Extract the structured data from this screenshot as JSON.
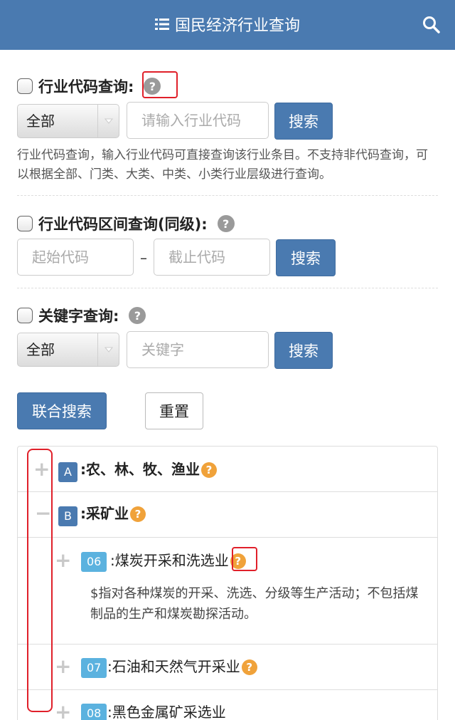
{
  "header": {
    "title": "国民经济行业查询",
    "list_icon": "list-icon",
    "search_icon": "search-icon"
  },
  "code_query": {
    "label": "行业代码查询:",
    "select_value": "全部",
    "input_placeholder": "请输入行业代码",
    "button": "搜索",
    "description": "行业代码查询，输入行业代码可直接查询该行业条目。不支持非代码查询，可以根据全部、门类、大类、中类、小类行业层级进行查询。"
  },
  "range_query": {
    "label": "行业代码区间查询(同级):",
    "start_placeholder": "起始代码",
    "separator": "–",
    "end_placeholder": "截止代码",
    "button": "搜索"
  },
  "keyword_query": {
    "label": "关键字查询:",
    "select_value": "全部",
    "input_placeholder": "关键字",
    "button": "搜索"
  },
  "actions": {
    "combined_search": "联合搜索",
    "reset": "重置"
  },
  "help_glyph": "?",
  "tree": {
    "rows": [
      {
        "toggle": "+",
        "code": "A",
        "label": ":农、林、牧、渔业",
        "level": 1
      },
      {
        "toggle": "−",
        "code": "B",
        "label": ":采矿业",
        "level": 1
      },
      {
        "toggle": "+",
        "code": "06",
        "label": ":煤炭开采和洗选业",
        "level": 2,
        "description": "$指对各种煤炭的开采、洗选、分级等生产活动；不包括煤制品的生产和煤炭勘探活动。"
      },
      {
        "toggle": "+",
        "code": "07",
        "label": ":石油和天然气开采业",
        "level": 2
      },
      {
        "toggle": "+",
        "code": "08",
        "label": ":黑色金属矿采选业",
        "level": 2
      }
    ]
  },
  "colors": {
    "primary": "#4a7ab0",
    "badge_light": "#5bb2df",
    "info_orange": "#f0a23a",
    "annotation_red": "#e0202a"
  }
}
